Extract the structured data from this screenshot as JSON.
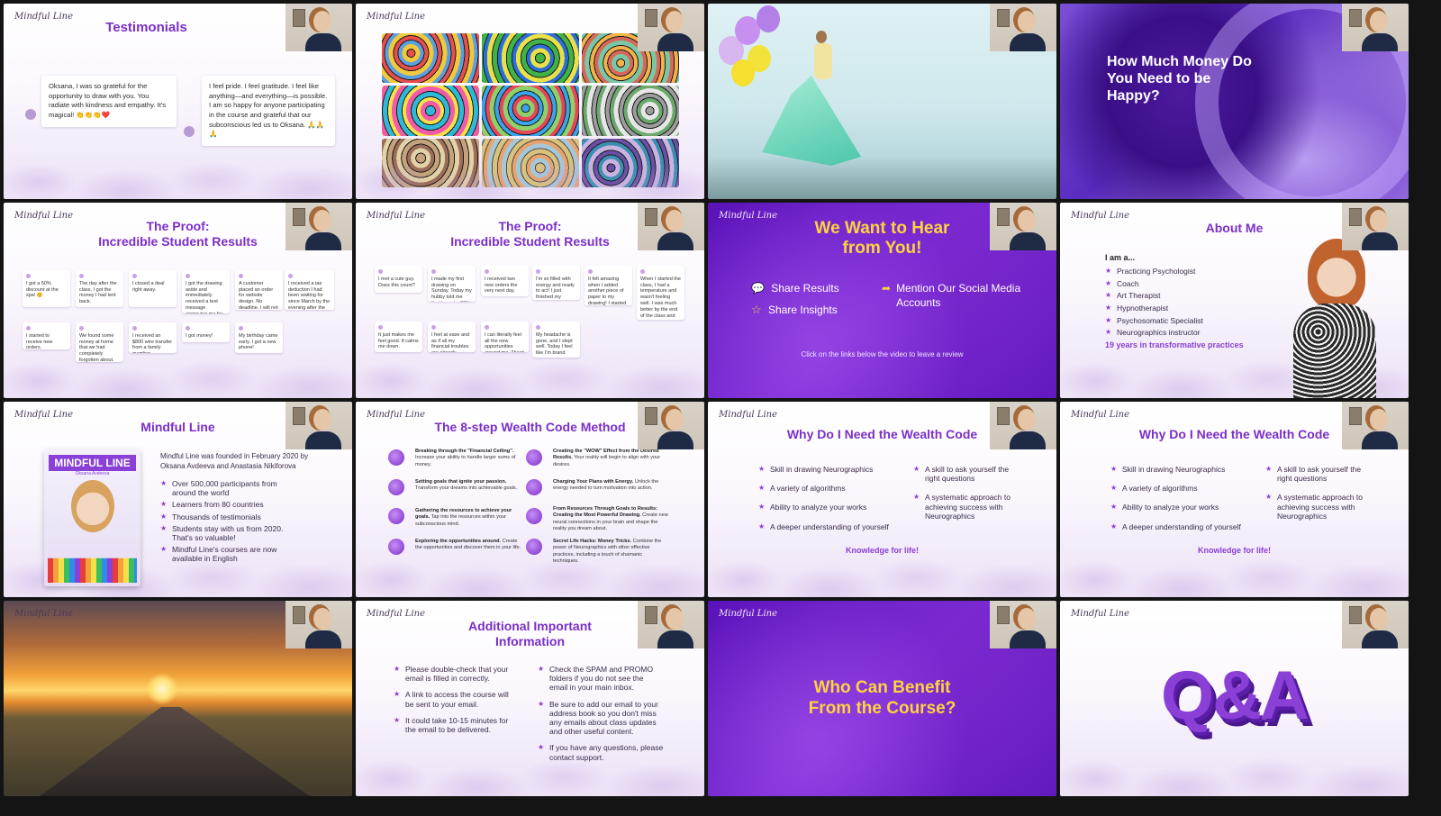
{
  "logo": "Mindful Line",
  "slides": {
    "testimonials": {
      "title": "Testimonials",
      "quote1": "Oksana, I was so grateful for the opportunity to draw with you. You radiate with kindness and empathy. It's magical! 👏👏👏❤️",
      "quote2": "I feel pride. I feel gratitude. I feel like anything—and everything—is possible. I am so happy for anyone participating in the course and grateful that our subconscious led us to Oksana. 🙏🙏🙏"
    },
    "money": {
      "title": "How Much Money Do You Need to be Happy?"
    },
    "proof1": {
      "title_line1": "The Proof:",
      "title_line2": "Incredible Student Results",
      "cards": [
        "I got a 50% discount at the spa! 😊",
        "The day after the class, I got the money I had lent back.",
        "I closed a deal right away.",
        "I got the drawing aside and immediately received a text message approving me for a loan with a lower interest rate! 😀",
        "A customer placed an order for website design. No deadline. I will not be in a hurry this time.",
        "I received a tax deduction I had been waiting for since March by the evening after the class.",
        "I started to receive new orders.",
        "We found some money at home that we had completely forgotten about. Now we can make use of it!",
        "I received an $800 wire transfer from a family member.",
        "I got money!",
        "My birthday came early. I got a new phone!"
      ]
    },
    "proof2": {
      "title_line1": "The Proof:",
      "title_line2": "Incredible Student Results",
      "cards": [
        "I met a cute guy. Does this count?",
        "I made my first drawing on Sunday. Today my hubby told me that he got a 30% raise! 😀",
        "I received two new orders the very next day.",
        "I'm so filled with energy and ready to act! I just finished my drawing 🙂",
        "It felt amazing when I added another piece of paper to my drawing! I started to feel less anything was possible.",
        "When I started the class, I had a temperature and wasn't feeling well. I was much better by the end of the class and felt fine by nighttime.",
        "It just makes me feel good. It calms me down.",
        "I feel at ease and as if all my financial troubles are already resolved.",
        "I can literally feel all the new opportunities around me. Thank you!",
        "My headache is gone, and I slept well. Today I feel like I'm brand new."
      ]
    },
    "hear": {
      "title_line1": "We Want to Hear",
      "title_line2": "from You!",
      "item1": "Share Results",
      "item2": "Share Insights",
      "item3": "Mention Our Social Media Accounts",
      "footer": "Click on the links below the video to leave a review"
    },
    "about": {
      "title": "About Me",
      "intro": "I am a...",
      "items": [
        "Practicing Psychologist",
        "Coach",
        "Art Therapist",
        "Hypnotherapist",
        "Psychosomatic Specialist",
        "Neurographics instructor"
      ],
      "years": "19 years in transformative practices"
    },
    "mindful": {
      "title": "Mindful Line",
      "book_title": "MINDFUL LINE",
      "book_sub": "Oksana Avdeeva",
      "intro": "Mindful Line was founded in February 2020 by Oksana Avdeeva and Anastasia Nikiforova",
      "items": [
        "Over 500,000 participants from around the world",
        "Learners from 80 countries",
        "Thousands of testimonials",
        "Students stay with us from 2020. That's so valuable!",
        "Mindful Line's courses are now available in English"
      ]
    },
    "method": {
      "title": "The 8-step Wealth Code Method",
      "steps": [
        {
          "head": "Breaking through the \"Financial Ceiling\".",
          "body": "Increase your ability to handle larger sums of money."
        },
        {
          "head": "Setting goals that ignite your passion.",
          "body": "Transform your dreams into achievable goals."
        },
        {
          "head": "Gathering the resources to achieve your goals.",
          "body": "Tap into the resources within your subconscious mind."
        },
        {
          "head": "Exploring the opportunities around.",
          "body": "Create the opportunities and discover them in your life."
        },
        {
          "head": "Creating the \"WOW\" Effect from the Desired Results.",
          "body": "Your reality will begin to align with your desires."
        },
        {
          "head": "Charging Your Plans with Energy.",
          "body": "Unlock the energy needed to turn motivation into action."
        },
        {
          "head": "From Resources Through Goals to Results: Creating the Most Powerful Drawing.",
          "body": "Create new neural connections in your brain and shape the reality you dream about."
        },
        {
          "head": "Secret Life Hacks: Money Tricks.",
          "body": "Combine the power of Neurographics with other effective practices, including a touch of shamanic techniques."
        }
      ]
    },
    "why1": {
      "title": "Why Do I Need the Wealth Code",
      "left": [
        "Skill in drawing Neurographics",
        "A variety of algorithms",
        "Ability to analyze your works",
        "A deeper understanding of yourself"
      ],
      "right": [
        "A skill to ask yourself the right questions",
        "A systematic approach to achieving success with Neurographics"
      ],
      "footer": "Knowledge for life!"
    },
    "why2": {
      "title": "Why Do I Need the Wealth Code",
      "left": [
        "Skill in drawing Neurographics",
        "A variety of algorithms",
        "Ability to analyze your works",
        "A deeper understanding of yourself"
      ],
      "right": [
        "A skill to ask yourself the right questions",
        "A systematic approach to achieving success with Neurographics"
      ],
      "footer": "Knowledge for life!"
    },
    "info": {
      "title_line1": "Additional Important",
      "title_line2": "Information",
      "left": [
        "Please double-check that your email is filled in correctly.",
        "A link to access the course will be sent to your email.",
        "It could take 10-15 minutes for the email to be delivered."
      ],
      "right": [
        "Check the SPAM and PROMO folders if you do not see the email in your main inbox.",
        "Be sure to add our email to your address book so you don't miss any emails about class updates and other useful content.",
        "If you have any questions, please contact support."
      ]
    },
    "benefit": {
      "title_line1": "Who Can Benefit",
      "title_line2": "From the Course?"
    },
    "qa": {
      "text": "Q&A"
    }
  }
}
